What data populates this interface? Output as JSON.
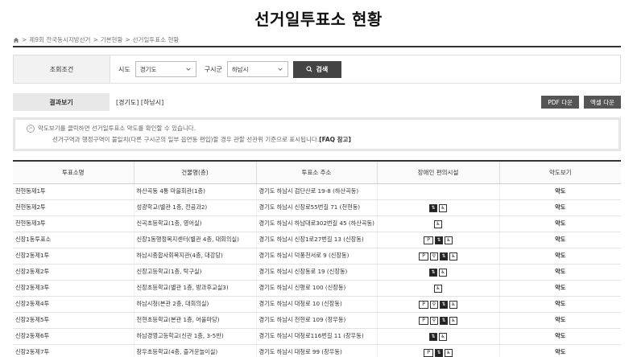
{
  "page": {
    "title": "선거일투표소 현황"
  },
  "breadcrumb": [
    "제9회 전국동시지방선거",
    "기본현황",
    "선거일투표소 현황"
  ],
  "search": {
    "label": "조회조건",
    "sido_label": "시도",
    "sido_value": "경기도",
    "gu_label": "구시군",
    "gu_value": "하남시",
    "button": "검색"
  },
  "result": {
    "label": "결과보기",
    "text": "[경기도] [하남시]",
    "pdf_button": "PDF 다운",
    "excel_button": "엑셀 다운"
  },
  "notice": {
    "line1": "약도보기를 클릭하면 선거일투표소 약도를 확인할 수 있습니다.",
    "line2": "선거구역과 행정구역이 불일치(다른 구시군의 일부 읍면동 편입)할 경우 관할 선관위 기준으로 표시됩니다.",
    "faq": "[FAQ 참고]"
  },
  "table": {
    "headers": [
      "투표소명",
      "건물명(층)",
      "투표소 주소",
      "장애인 편의시설",
      "약도보기"
    ],
    "rows": [
      {
        "name": "천현동제1투",
        "building": "하산곡동 4통 마을회관(1층)",
        "address": "경기도 하남시 검단산로 19-8 (하산곡동)",
        "map": "약도",
        "fac": []
      },
      {
        "name": "천현동제2투",
        "building": "성광학교(별관 1층, 전공과2)",
        "address": "경기도 하남시 신장로55번길 71 (천현동)",
        "map": "약도",
        "fac": [
          "elevator",
          "wheelchair"
        ]
      },
      {
        "name": "천현동제3투",
        "building": "신곡초등학교(1층, 영어실)",
        "address": "경기도 하남시 하남대로302번길 45 (하산곡동)",
        "map": "약도",
        "fac": [
          "wheelchair"
        ]
      },
      {
        "name": "신장1동투표소",
        "building": "신장1동행정복지센터(별관 4층, 대회의실)",
        "address": "경기도 하남시 신장1로27번길 13 (신장동)",
        "map": "약도",
        "fac": [
          "parking",
          "elevator",
          "wheelchair"
        ]
      },
      {
        "name": "신장2동제1투",
        "building": "하남시종합사회복지관(4층, 대강당)",
        "address": "경기도 하남시 덕풍천서로 9 (신장동)",
        "map": "약도",
        "fac": [
          "parking",
          "toilet",
          "elevator",
          "wheelchair"
        ]
      },
      {
        "name": "신장2동제2투",
        "building": "신장고등학교(1층, 탁구실)",
        "address": "경기도 하남시 신장동로 19 (신장동)",
        "map": "약도",
        "fac": [
          "elevator",
          "wheelchair"
        ]
      },
      {
        "name": "신장2동제3투",
        "building": "신장초등학교(별관 1층, 방과후교실3)",
        "address": "경기도 하남시 신평로 100 (신장동)",
        "map": "약도",
        "fac": [
          "wheelchair"
        ]
      },
      {
        "name": "신장2동제4투",
        "building": "하남시청(본관 2층, 대회의실)",
        "address": "경기도 하남시 대청로 10 (신장동)",
        "map": "약도",
        "fac": [
          "parking",
          "toilet",
          "elevator",
          "wheelchair"
        ]
      },
      {
        "name": "신장2동제5투",
        "building": "천현초등학교(본관 1층, 어울마당)",
        "address": "경기도 하남시 천현로 109 (창우동)",
        "map": "약도",
        "fac": [
          "parking",
          "toilet",
          "elevator",
          "wheelchair"
        ]
      },
      {
        "name": "신장2동제6투",
        "building": "하남경영고등학교(신관 1층, 3-5반)",
        "address": "경기도 하남시 대청로116번길 11 (창우동)",
        "map": "약도",
        "fac": [
          "elevator",
          "wheelchair"
        ]
      },
      {
        "name": "신장2동제7투",
        "building": "창우초등학교(4층, 즐거운놀이실)",
        "address": "경기도 하남시 대청로 99 (창우동)",
        "map": "약도",
        "fac": [
          "parking",
          "elevator",
          "wheelchair"
        ]
      }
    ]
  },
  "icons": {
    "home": "home-icon",
    "search": "search-icon",
    "chevron": "chevron-down-icon",
    "facility_glyphs": {
      "parking": "P",
      "toilet": "♿",
      "elevator": "E",
      "wheelchair": "♿"
    }
  }
}
